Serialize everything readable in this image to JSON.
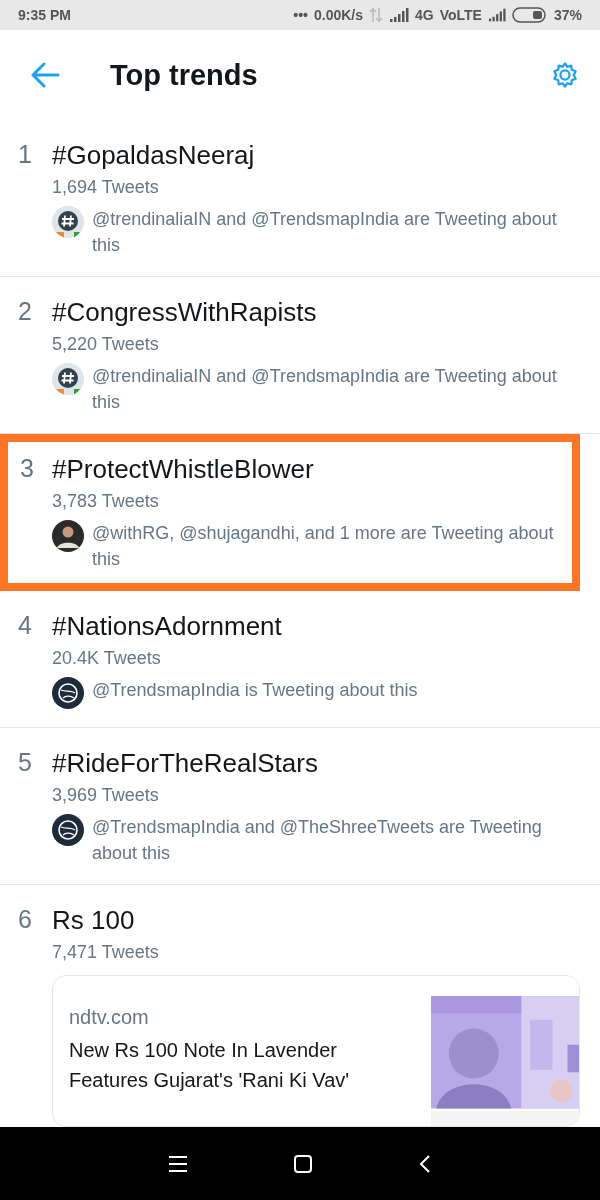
{
  "status_bar": {
    "time": "9:35 PM",
    "dots": "•••",
    "speed": "0.00K/s",
    "network": "4G",
    "volte": "VoLTE",
    "battery": "37%"
  },
  "header": {
    "title": "Top trends"
  },
  "trends": [
    {
      "rank": "1",
      "name": "#GopaldasNeeraj",
      "count": "1,694 Tweets",
      "kind": "social",
      "context": "@trendinaliaIN and @TrendsmapIndia are Tweeting about this",
      "highlighted": false
    },
    {
      "rank": "2",
      "name": "#CongressWithRapists",
      "count": "5,220 Tweets",
      "kind": "social",
      "context": "@trendinaliaIN and @TrendsmapIndia are Tweeting about this",
      "highlighted": false
    },
    {
      "rank": "3",
      "name": "#ProtectWhistleBlower",
      "count": "3,783 Tweets",
      "kind": "social",
      "context": "@withRG, @shujagandhi, and 1 more are Tweeting about this",
      "highlighted": true
    },
    {
      "rank": "4",
      "name": "#NationsAdornment",
      "count": "20.4K Tweets",
      "kind": "social",
      "context": "@TrendsmapIndia is Tweeting about this",
      "highlighted": false
    },
    {
      "rank": "5",
      "name": "#RideForTheRealStars",
      "count": "3,969 Tweets",
      "kind": "social",
      "context": "@TrendsmapIndia and @TheShreeTweets are Tweeting about this",
      "highlighted": false
    },
    {
      "rank": "6",
      "name": "Rs 100",
      "count": "7,471 Tweets",
      "kind": "card",
      "source": "ndtv.com",
      "headline": "New Rs 100 Note In Lavender Features Gujarat's 'Rani Ki Vav'",
      "highlighted": false
    }
  ]
}
